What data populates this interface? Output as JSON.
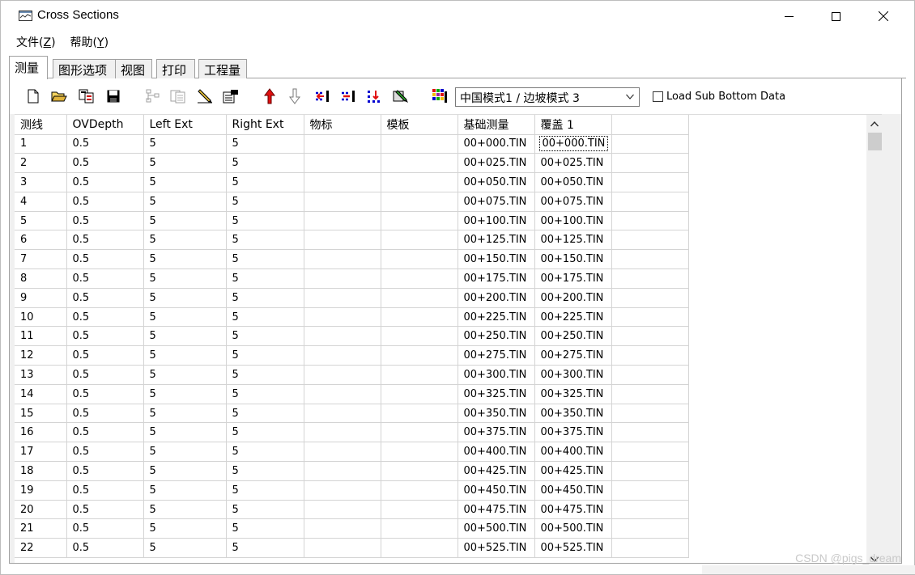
{
  "window": {
    "title": "Cross Sections"
  },
  "menu": [
    {
      "label": "文件(",
      "key": "Z",
      "suffix": ")"
    },
    {
      "label": "帮助(",
      "key": "Y",
      "suffix": ")"
    }
  ],
  "tabs": [
    "测量",
    "图形选项",
    "视图",
    "打印",
    "工程量"
  ],
  "active_tab": 0,
  "toolbar": {
    "icons": [
      "new-file-icon",
      "open-folder-icon",
      "paste-icon",
      "save-icon",
      "tree-disabled-icon",
      "copy-disabled-icon",
      "pencil-icon",
      "properties-icon",
      "arrow-up-red-icon",
      "arrow-down-outline-icon",
      "insert-row-icon",
      "delete-row-icon",
      "grid-dots-icon",
      "edit-select-icon",
      "color-pattern-icon"
    ],
    "mode_select_value": "中国模式1 / 边坡模式 3",
    "load_sub_bottom_label": "Load Sub Bottom Data",
    "load_sub_bottom_checked": false
  },
  "grid": {
    "headers": [
      "测线",
      "OVDepth",
      "Left Ext",
      "Right Ext",
      "物标",
      "模板",
      "基础测量",
      "覆盖 1",
      ""
    ],
    "rows": [
      [
        "1",
        "0.5",
        "5",
        "5",
        "",
        "",
        "00+000.TIN",
        "00+000.TIN"
      ],
      [
        "2",
        "0.5",
        "5",
        "5",
        "",
        "",
        "00+025.TIN",
        "00+025.TIN"
      ],
      [
        "3",
        "0.5",
        "5",
        "5",
        "",
        "",
        "00+050.TIN",
        "00+050.TIN"
      ],
      [
        "4",
        "0.5",
        "5",
        "5",
        "",
        "",
        "00+075.TIN",
        "00+075.TIN"
      ],
      [
        "5",
        "0.5",
        "5",
        "5",
        "",
        "",
        "00+100.TIN",
        "00+100.TIN"
      ],
      [
        "6",
        "0.5",
        "5",
        "5",
        "",
        "",
        "00+125.TIN",
        "00+125.TIN"
      ],
      [
        "7",
        "0.5",
        "5",
        "5",
        "",
        "",
        "00+150.TIN",
        "00+150.TIN"
      ],
      [
        "8",
        "0.5",
        "5",
        "5",
        "",
        "",
        "00+175.TIN",
        "00+175.TIN"
      ],
      [
        "9",
        "0.5",
        "5",
        "5",
        "",
        "",
        "00+200.TIN",
        "00+200.TIN"
      ],
      [
        "10",
        "0.5",
        "5",
        "5",
        "",
        "",
        "00+225.TIN",
        "00+225.TIN"
      ],
      [
        "11",
        "0.5",
        "5",
        "5",
        "",
        "",
        "00+250.TIN",
        "00+250.TIN"
      ],
      [
        "12",
        "0.5",
        "5",
        "5",
        "",
        "",
        "00+275.TIN",
        "00+275.TIN"
      ],
      [
        "13",
        "0.5",
        "5",
        "5",
        "",
        "",
        "00+300.TIN",
        "00+300.TIN"
      ],
      [
        "14",
        "0.5",
        "5",
        "5",
        "",
        "",
        "00+325.TIN",
        "00+325.TIN"
      ],
      [
        "15",
        "0.5",
        "5",
        "5",
        "",
        "",
        "00+350.TIN",
        "00+350.TIN"
      ],
      [
        "16",
        "0.5",
        "5",
        "5",
        "",
        "",
        "00+375.TIN",
        "00+375.TIN"
      ],
      [
        "17",
        "0.5",
        "5",
        "5",
        "",
        "",
        "00+400.TIN",
        "00+400.TIN"
      ],
      [
        "18",
        "0.5",
        "5",
        "5",
        "",
        "",
        "00+425.TIN",
        "00+425.TIN"
      ],
      [
        "19",
        "0.5",
        "5",
        "5",
        "",
        "",
        "00+450.TIN",
        "00+450.TIN"
      ],
      [
        "20",
        "0.5",
        "5",
        "5",
        "",
        "",
        "00+475.TIN",
        "00+475.TIN"
      ],
      [
        "21",
        "0.5",
        "5",
        "5",
        "",
        "",
        "00+500.TIN",
        "00+500.TIN"
      ],
      [
        "22",
        "0.5",
        "5",
        "5",
        "",
        "",
        "00+525.TIN",
        "00+525.TIN"
      ]
    ],
    "focused_cell": {
      "row": 0,
      "col": 7
    }
  },
  "watermark": "CSDN @pigs_dream",
  "colors": {
    "tab_bg": "#f0f0f0",
    "grid_line": "#d4d4d4",
    "scroll_thumb": "#cdcdcd"
  }
}
